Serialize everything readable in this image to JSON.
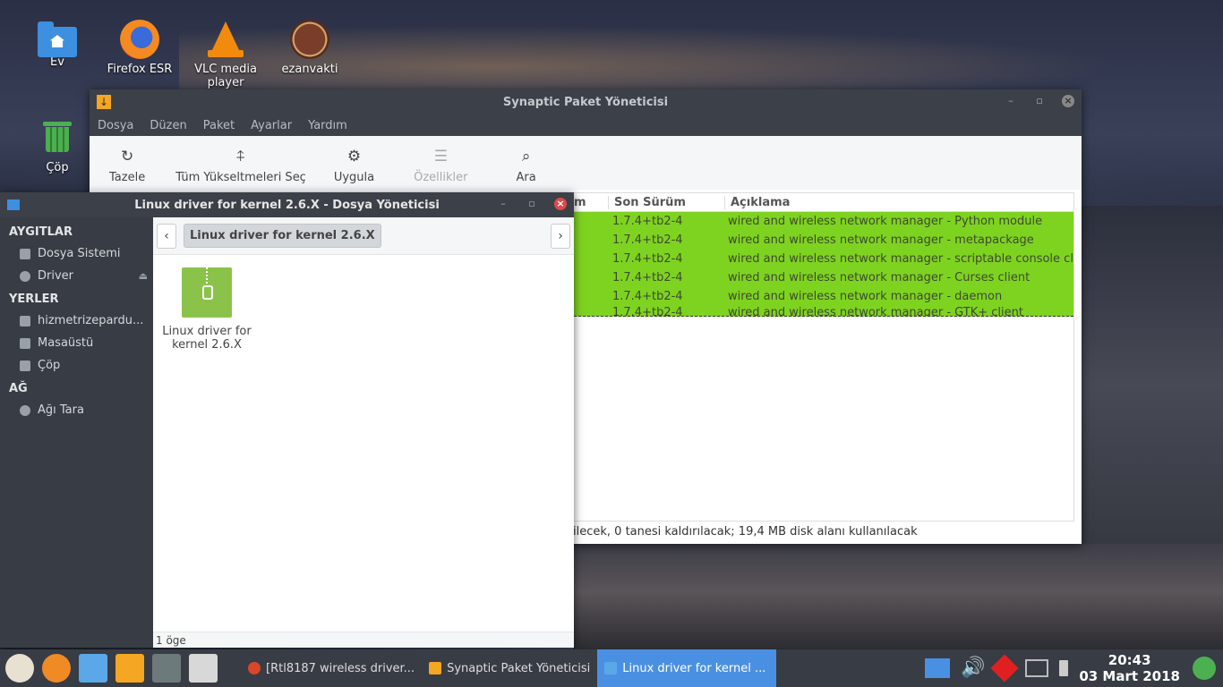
{
  "desktop": {
    "icons": [
      {
        "label": "Ev",
        "icon": "home-folder-icon"
      },
      {
        "label": "Firefox ESR",
        "icon": "firefox-icon"
      },
      {
        "label": "VLC media player",
        "icon": "vlc-icon"
      },
      {
        "label": "ezanvakti",
        "icon": "ezanvakti-icon"
      },
      {
        "label": "Çöp",
        "icon": "trash-icon"
      }
    ]
  },
  "synaptic": {
    "title": "Synaptic Paket Yöneticisi",
    "menu": [
      "Dosya",
      "Düzen",
      "Paket",
      "Ayarlar",
      "Yardım"
    ],
    "toolbar": [
      {
        "label": "Tazele",
        "icon": "refresh-icon"
      },
      {
        "label": "Tüm Yükseltmeleri Seç",
        "icon": "upgrade-icon"
      },
      {
        "label": "Uygula",
        "icon": "apply-icon"
      },
      {
        "label": "Özellikler",
        "icon": "properties-icon"
      },
      {
        "label": "Ara",
        "icon": "search-icon"
      }
    ],
    "columns": {
      "partial": "m",
      "version": "Son Sürüm",
      "description": "Açıklama"
    },
    "rows": [
      {
        "version": "1.7.4+tb2-4",
        "description": "wired and wireless network manager - Python module"
      },
      {
        "version": "1.7.4+tb2-4",
        "description": "wired and wireless network manager - metapackage"
      },
      {
        "version": "1.7.4+tb2-4",
        "description": "wired and wireless network manager - scriptable console cl"
      },
      {
        "version": "1.7.4+tb2-4",
        "description": "wired and wireless network manager - Curses client"
      },
      {
        "version": "1.7.4+tb2-4",
        "description": "wired and wireless network manager - daemon"
      },
      {
        "version": "1.7.4+tb2-4",
        "description": "wired and wireless network manager - GTK+ client"
      }
    ],
    "status": "ilecek, 0 tanesi kaldırılacak; 19,4 MB disk alanı kullanılacak"
  },
  "filemanager": {
    "title": "Linux driver for kernel 2.6.X - Dosya Yöneticisi",
    "sidebar": {
      "devices_header": "AYGITLAR",
      "devices": [
        "Dosya Sistemi",
        "Driver"
      ],
      "places_header": "YERLER",
      "places": [
        "hizmetrizepardu...",
        "Masaüstü",
        "Çöp"
      ],
      "network_header": "AĞ",
      "network": [
        "Ağı Tara"
      ]
    },
    "breadcrumb": "Linux driver for kernel 2.6.X",
    "file_label": "Linux driver for kernel 2.6.X",
    "status": "1 öge"
  },
  "taskbar": {
    "tasks": [
      {
        "label": "[Rtl8187 wireless driver...",
        "active": false
      },
      {
        "label": "Synaptic Paket Yöneticisi",
        "active": false
      },
      {
        "label": "Linux driver for kernel ...",
        "active": true
      }
    ],
    "time": "20:43",
    "date": "03 Mart 2018"
  }
}
